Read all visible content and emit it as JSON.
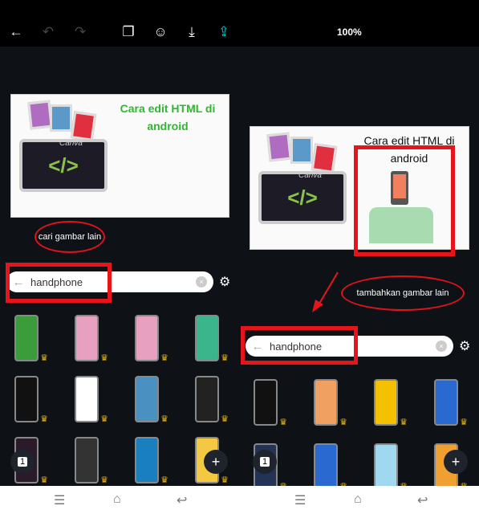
{
  "toolbar": {
    "zoom": "100%",
    "icons": [
      "back-arrow",
      "undo",
      "redo",
      "copy-pages",
      "collaborate",
      "download",
      "share"
    ]
  },
  "left": {
    "design_title": "Cara edit HTML di android",
    "watermark": "Canva",
    "callout": "cari gambar lain",
    "search_value": "handphone"
  },
  "right": {
    "design_title": "Cara edit HTML di android",
    "watermark": "Canva",
    "callout": "tambahkan gambar lain",
    "search_value": "handphone"
  },
  "page_badge": "1",
  "add_label": "+",
  "colors": {
    "accent": "#00c4cc",
    "annotation": "#e8141c",
    "title_green": "#2eb82e",
    "crown": "#f5b800"
  },
  "left_grid": [
    "#3a9c3a",
    "#e8a0c0",
    "#e8a0c0",
    "#3bb58c",
    "#111111",
    "#ffffff",
    "#4a90c0",
    "#222222",
    "#2a1a2a",
    "#333333",
    "#1a7fbf",
    "#f5c842"
  ],
  "right_grid": [
    "#111111",
    "#f0a060",
    "#f5c000",
    "#2a6ad0",
    "#223355",
    "#2a6ad0",
    "#a0d8f0",
    "#f0a030"
  ]
}
